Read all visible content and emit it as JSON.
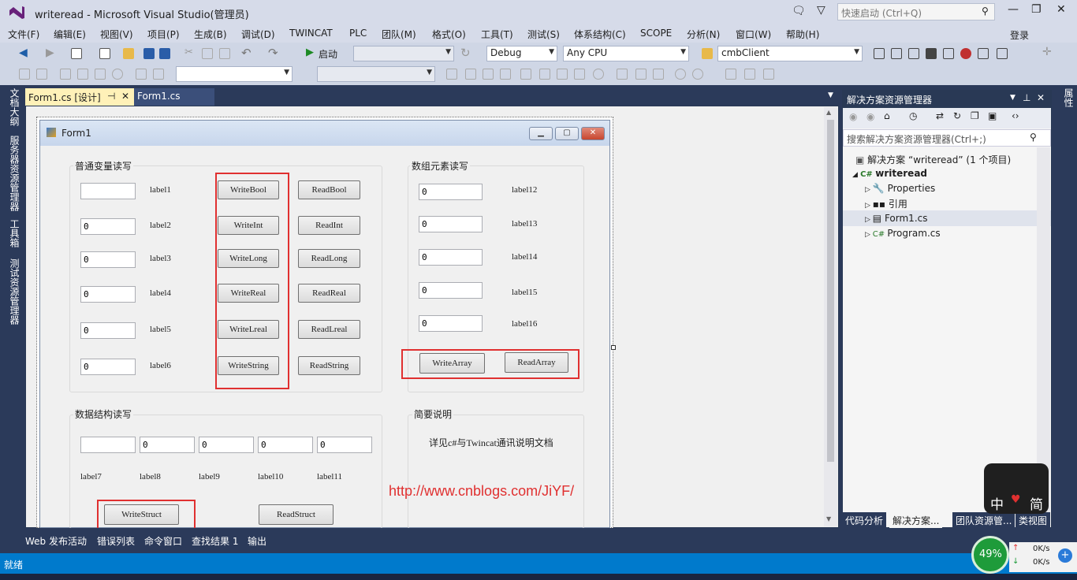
{
  "window": {
    "title": "writeread - Microsoft Visual Studio(管理员)",
    "quick_launch": "快速启动 (Ctrl+Q)"
  },
  "menu": [
    "文件(F)",
    "编辑(E)",
    "视图(V)",
    "项目(P)",
    "生成(B)",
    "调试(D)",
    "TWINCAT",
    "PLC",
    "团队(M)",
    "格式(O)",
    "工具(T)",
    "测试(S)",
    "体系结构(C)",
    "SCOPE",
    "分析(N)",
    "窗口(W)",
    "帮助(H)"
  ],
  "login": "登录",
  "toolbar": {
    "start": "启动",
    "config": "Debug",
    "platform": "Any CPU",
    "project": "cmbClient"
  },
  "left_tabs": [
    "文档大纲",
    "服务器资源管理器",
    "工具箱",
    "测试资源管理器"
  ],
  "doc_tabs": {
    "active": "Form1.cs [设计]",
    "pin": "⊣",
    "close": "✕",
    "other": "Form1.cs"
  },
  "form": {
    "title": "Form1",
    "group1": {
      "title": "普通变量读写",
      "textboxes": [
        "",
        "0",
        "0",
        "0",
        "0",
        "0"
      ],
      "labels": [
        "label1",
        "label2",
        "label3",
        "label4",
        "label5",
        "label6"
      ],
      "write_buttons": [
        "WriteBool",
        "WriteInt",
        "WriteLong",
        "WriteReal",
        "WriteLreal",
        "WriteString"
      ],
      "read_buttons": [
        "ReadBool",
        "ReadInt",
        "ReadLong",
        "ReadReal",
        "ReadLreal",
        "ReadString"
      ]
    },
    "group2": {
      "title": "数组元素读写",
      "textboxes": [
        "0",
        "0",
        "0",
        "0",
        "0"
      ],
      "labels": [
        "label12",
        "label13",
        "label14",
        "label15",
        "label16"
      ],
      "write_button": "WriteArray",
      "read_button": "ReadArray"
    },
    "group3": {
      "title": "数据结构读写",
      "textboxes": [
        "",
        "0",
        "0",
        "0",
        "0"
      ],
      "labels": [
        "label7",
        "label8",
        "label9",
        "label10",
        "label11"
      ],
      "write_button": "WriteStruct",
      "read_button": "ReadStruct"
    },
    "group4": {
      "title": "简要说明",
      "text": "详见c#与Twincat通讯说明文档"
    },
    "watermark_url": "http://www.cnblogs.com/JiYF/"
  },
  "solution": {
    "header": "解决方案资源管理器",
    "search": "搜索解决方案资源管理器(Ctrl+;)",
    "root": "解决方案 “writeread” (1 个项目)",
    "project": "writeread",
    "items": [
      "Properties",
      "引用",
      "Form1.cs",
      "Program.cs"
    ],
    "bottom_tabs": [
      "代码分析",
      "解决方案...",
      "团队资源管...",
      "类视图"
    ]
  },
  "right_strip": "属性",
  "bottom_tabs": [
    "Web 发布活动",
    "错误列表",
    "命令窗口",
    "查找结果 1",
    "输出"
  ],
  "status": "就绪",
  "ime": {
    "left": "中",
    "right": "简"
  },
  "network": {
    "percent": "49%",
    "up": "0K/s",
    "down": "0K/s"
  }
}
